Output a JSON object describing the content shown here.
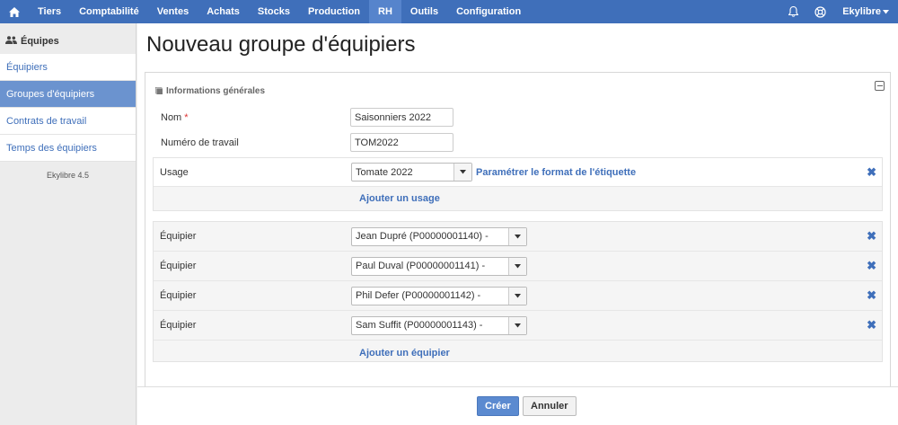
{
  "nav": {
    "items": [
      "Tiers",
      "Comptabilité",
      "Ventes",
      "Achats",
      "Stocks",
      "Production",
      "RH",
      "Outils",
      "Configuration"
    ],
    "active": "RH",
    "user": "Ekylibre"
  },
  "sidebar": {
    "title": "Équipes",
    "items": [
      {
        "label": "Équipiers"
      },
      {
        "label": "Groupes d'équipiers"
      },
      {
        "label": "Contrats de travail"
      },
      {
        "label": "Temps des équipiers"
      }
    ],
    "active_index": 1,
    "version": "Ekylibre 4.5"
  },
  "page": {
    "title": "Nouveau groupe d'équipiers"
  },
  "panel": {
    "title": "Informations générales",
    "name_label": "Nom",
    "required_mark": "*",
    "name_value": "Saisonniers 2022",
    "work_number_label": "Numéro de travail",
    "work_number_value": "TOM2022",
    "usage": {
      "label": "Usage",
      "value": "Tomate 2022",
      "link": "Paramétrer le format de l'étiquette",
      "add_label": "Ajouter un usage"
    },
    "workers": {
      "label": "Équipier",
      "items": [
        {
          "value": "Jean Dupré (P00000001140) -"
        },
        {
          "value": "Paul Duval (P00000001141) -"
        },
        {
          "value": "Phil Defer (P00000001142) -"
        },
        {
          "value": "Sam Suffit (P00000001143) -"
        }
      ],
      "add_label": "Ajouter un équipier"
    }
  },
  "actions": {
    "create": "Créer",
    "cancel": "Annuler"
  },
  "colors": {
    "nav_bg": "#3f6fba",
    "nav_active": "#5684cc",
    "link": "#3f6fba",
    "sidebar_active": "#6b93cf"
  }
}
